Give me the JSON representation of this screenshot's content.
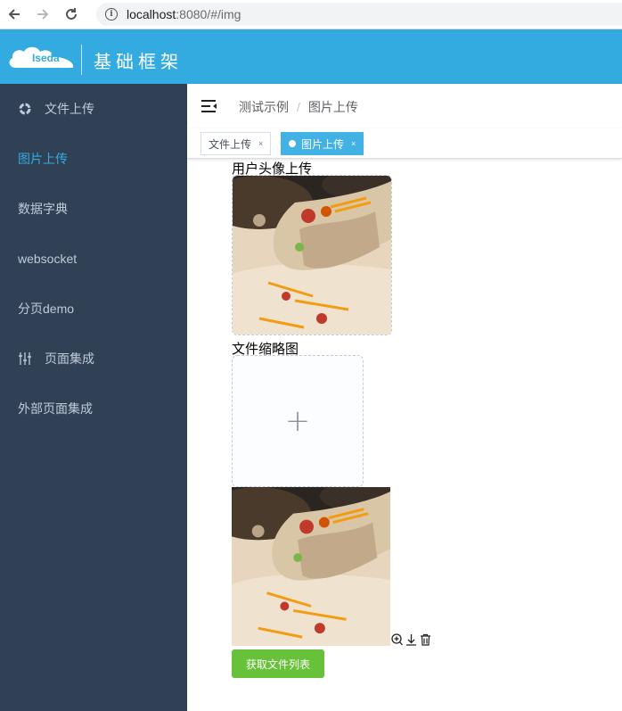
{
  "browser": {
    "url_host": "localhost",
    "url_path": ":8080/#/img"
  },
  "header": {
    "logo_text": "Iseda",
    "title": "基础框架"
  },
  "sidebar": {
    "items": [
      {
        "label": "文件上传",
        "icon": "gear-icon",
        "active": false
      },
      {
        "label": "图片上传",
        "icon": "",
        "active": true
      },
      {
        "label": "数据字典",
        "icon": "",
        "active": false
      },
      {
        "label": "websocket",
        "icon": "",
        "active": false
      },
      {
        "label": "分页demo",
        "icon": "",
        "active": false
      },
      {
        "label": "页面集成",
        "icon": "sliders-icon",
        "active": false
      },
      {
        "label": "外部页面集成",
        "icon": "",
        "active": false
      }
    ]
  },
  "breadcrumb": {
    "parent": "测试示例",
    "separator": "/",
    "current": "图片上传"
  },
  "tags": [
    {
      "label": "文件上传",
      "active": false,
      "close": "×"
    },
    {
      "label": "图片上传",
      "active": true,
      "close": "×"
    }
  ],
  "content": {
    "avatar_label": "用户头像上传",
    "thumbnail_label": "文件缩略图",
    "upload_plus": "+",
    "get_files_button": "获取文件列表"
  },
  "colors": {
    "header_bg": "#33abe0",
    "sidebar_bg": "#304156",
    "sidebar_active": "#33abe0",
    "button_green": "#67c23a"
  }
}
